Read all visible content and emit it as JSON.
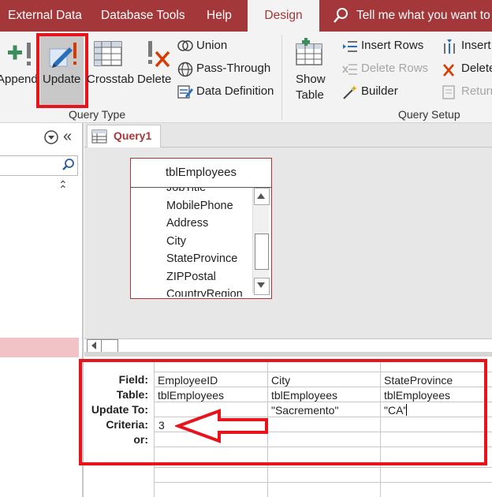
{
  "tabs": {
    "external_data": "External Data",
    "database_tools": "Database Tools",
    "help": "Help",
    "design": "Design",
    "tell_me": "Tell me what you want to"
  },
  "ribbon": {
    "append": "Append",
    "update": "Update",
    "crosstab": "Crosstab",
    "delete": "Delete",
    "union": "Union",
    "pass_through": "Pass-Through",
    "data_definition": "Data Definition",
    "query_type_label": "Query Type",
    "show_table_line1": "Show",
    "show_table_line2": "Table",
    "insert_rows": "Insert Rows",
    "delete_rows": "Delete Rows",
    "builder": "Builder",
    "insert": "Insert",
    "delete_col": "Delete",
    "return": "Return",
    "query_setup_label": "Query Setup"
  },
  "document": {
    "tab_label": "Query1"
  },
  "table_box": {
    "title": "tblEmployees",
    "fields": [
      "JobTitle",
      "MobilePhone",
      "Address",
      "City",
      "StateProvince",
      "ZIPPostal",
      "CountryRegion"
    ]
  },
  "grid": {
    "row_labels": [
      "Field:",
      "Table:",
      "Update To:",
      "Criteria:",
      "or:"
    ],
    "columns": [
      {
        "field": "EmployeeID",
        "table": "tblEmployees",
        "update_to": "",
        "criteria": "3"
      },
      {
        "field": "City",
        "table": "tblEmployees",
        "update_to": "\"Sacremento\"",
        "criteria": ""
      },
      {
        "field": "StateProvince",
        "table": "tblEmployees",
        "update_to": "\"CA\"",
        "criteria": ""
      }
    ]
  },
  "colors": {
    "accent": "#a4373a",
    "highlight_red": "#e8141b",
    "ribbon_bg": "#f3f3f3",
    "pane_bg": "#e7e7e7"
  }
}
